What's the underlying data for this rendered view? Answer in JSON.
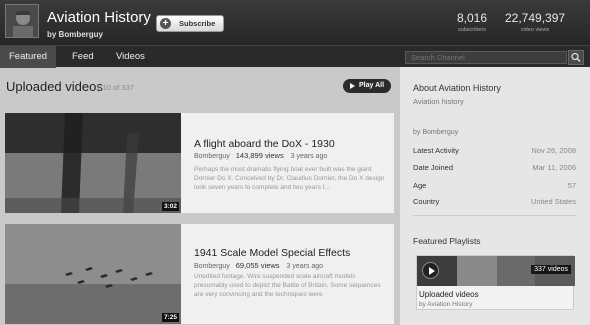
{
  "header": {
    "title": "Aviation History",
    "by": "by Bomberguy",
    "subscribe_label": "Subscribe",
    "stats": [
      {
        "value": "8,016",
        "label": "subscribers"
      },
      {
        "value": "22,749,397",
        "label": "video views"
      }
    ]
  },
  "nav": {
    "tabs": [
      {
        "label": "Featured"
      },
      {
        "label": "Feed"
      },
      {
        "label": "Videos"
      }
    ],
    "active_tab": "Featured",
    "search_placeholder": "Search Channel"
  },
  "uploads": {
    "title": "Uploaded videos",
    "count_text": "1-10 of 337",
    "play_all_label": "Play All",
    "videos": [
      {
        "title": "A flight aboard the DoX - 1930",
        "author": "Bomberguy",
        "views": "143,899 views",
        "age": "3 years ago",
        "description": "Perhaps the most dramatic flying boat ever built was the giant Dornier Do X. Conceived by Dr. Claudius Dornier, the Do X design took seven years to complete and two years t...",
        "duration": "3:02"
      },
      {
        "title": "1941 Scale Model Special Effects",
        "author": "Bomberguy",
        "views": "69,055 views",
        "age": "3 years ago",
        "description": "Unedited footage. Wire suspended scale aircraft models presumably used to depict the Battle of Britain. Some sequences are very convincing and the techniques were",
        "duration": "7:25"
      }
    ]
  },
  "about": {
    "title": "About Aviation History",
    "subtitle": "Aviation history",
    "by": "by Bomberguy",
    "rows": [
      {
        "label": "Latest Activity",
        "value": "Nov 26, 2008"
      },
      {
        "label": "Date Joined",
        "value": "Mar 11, 2006"
      },
      {
        "label": "Age",
        "value": "57"
      },
      {
        "label": "Country",
        "value": "United States"
      }
    ]
  },
  "featured_playlists": {
    "title": "Featured Playlists",
    "playlists": [
      {
        "name": "Uploaded videos",
        "by": "by Aviation History",
        "count": "337 videos"
      }
    ]
  },
  "colors": {
    "header_bg": "#2e2e2e",
    "nav_bg": "#2a2a2a",
    "active_tab_bg": "#4a4a4a",
    "page_bg": "#c9c9c9",
    "card_bg": "#f0f0f0",
    "sidebar_bg": "#e6e6e6"
  },
  "icons": [
    "subscribe-plus-icon",
    "search-icon",
    "play-all-icon",
    "playlist-play-icon"
  ]
}
